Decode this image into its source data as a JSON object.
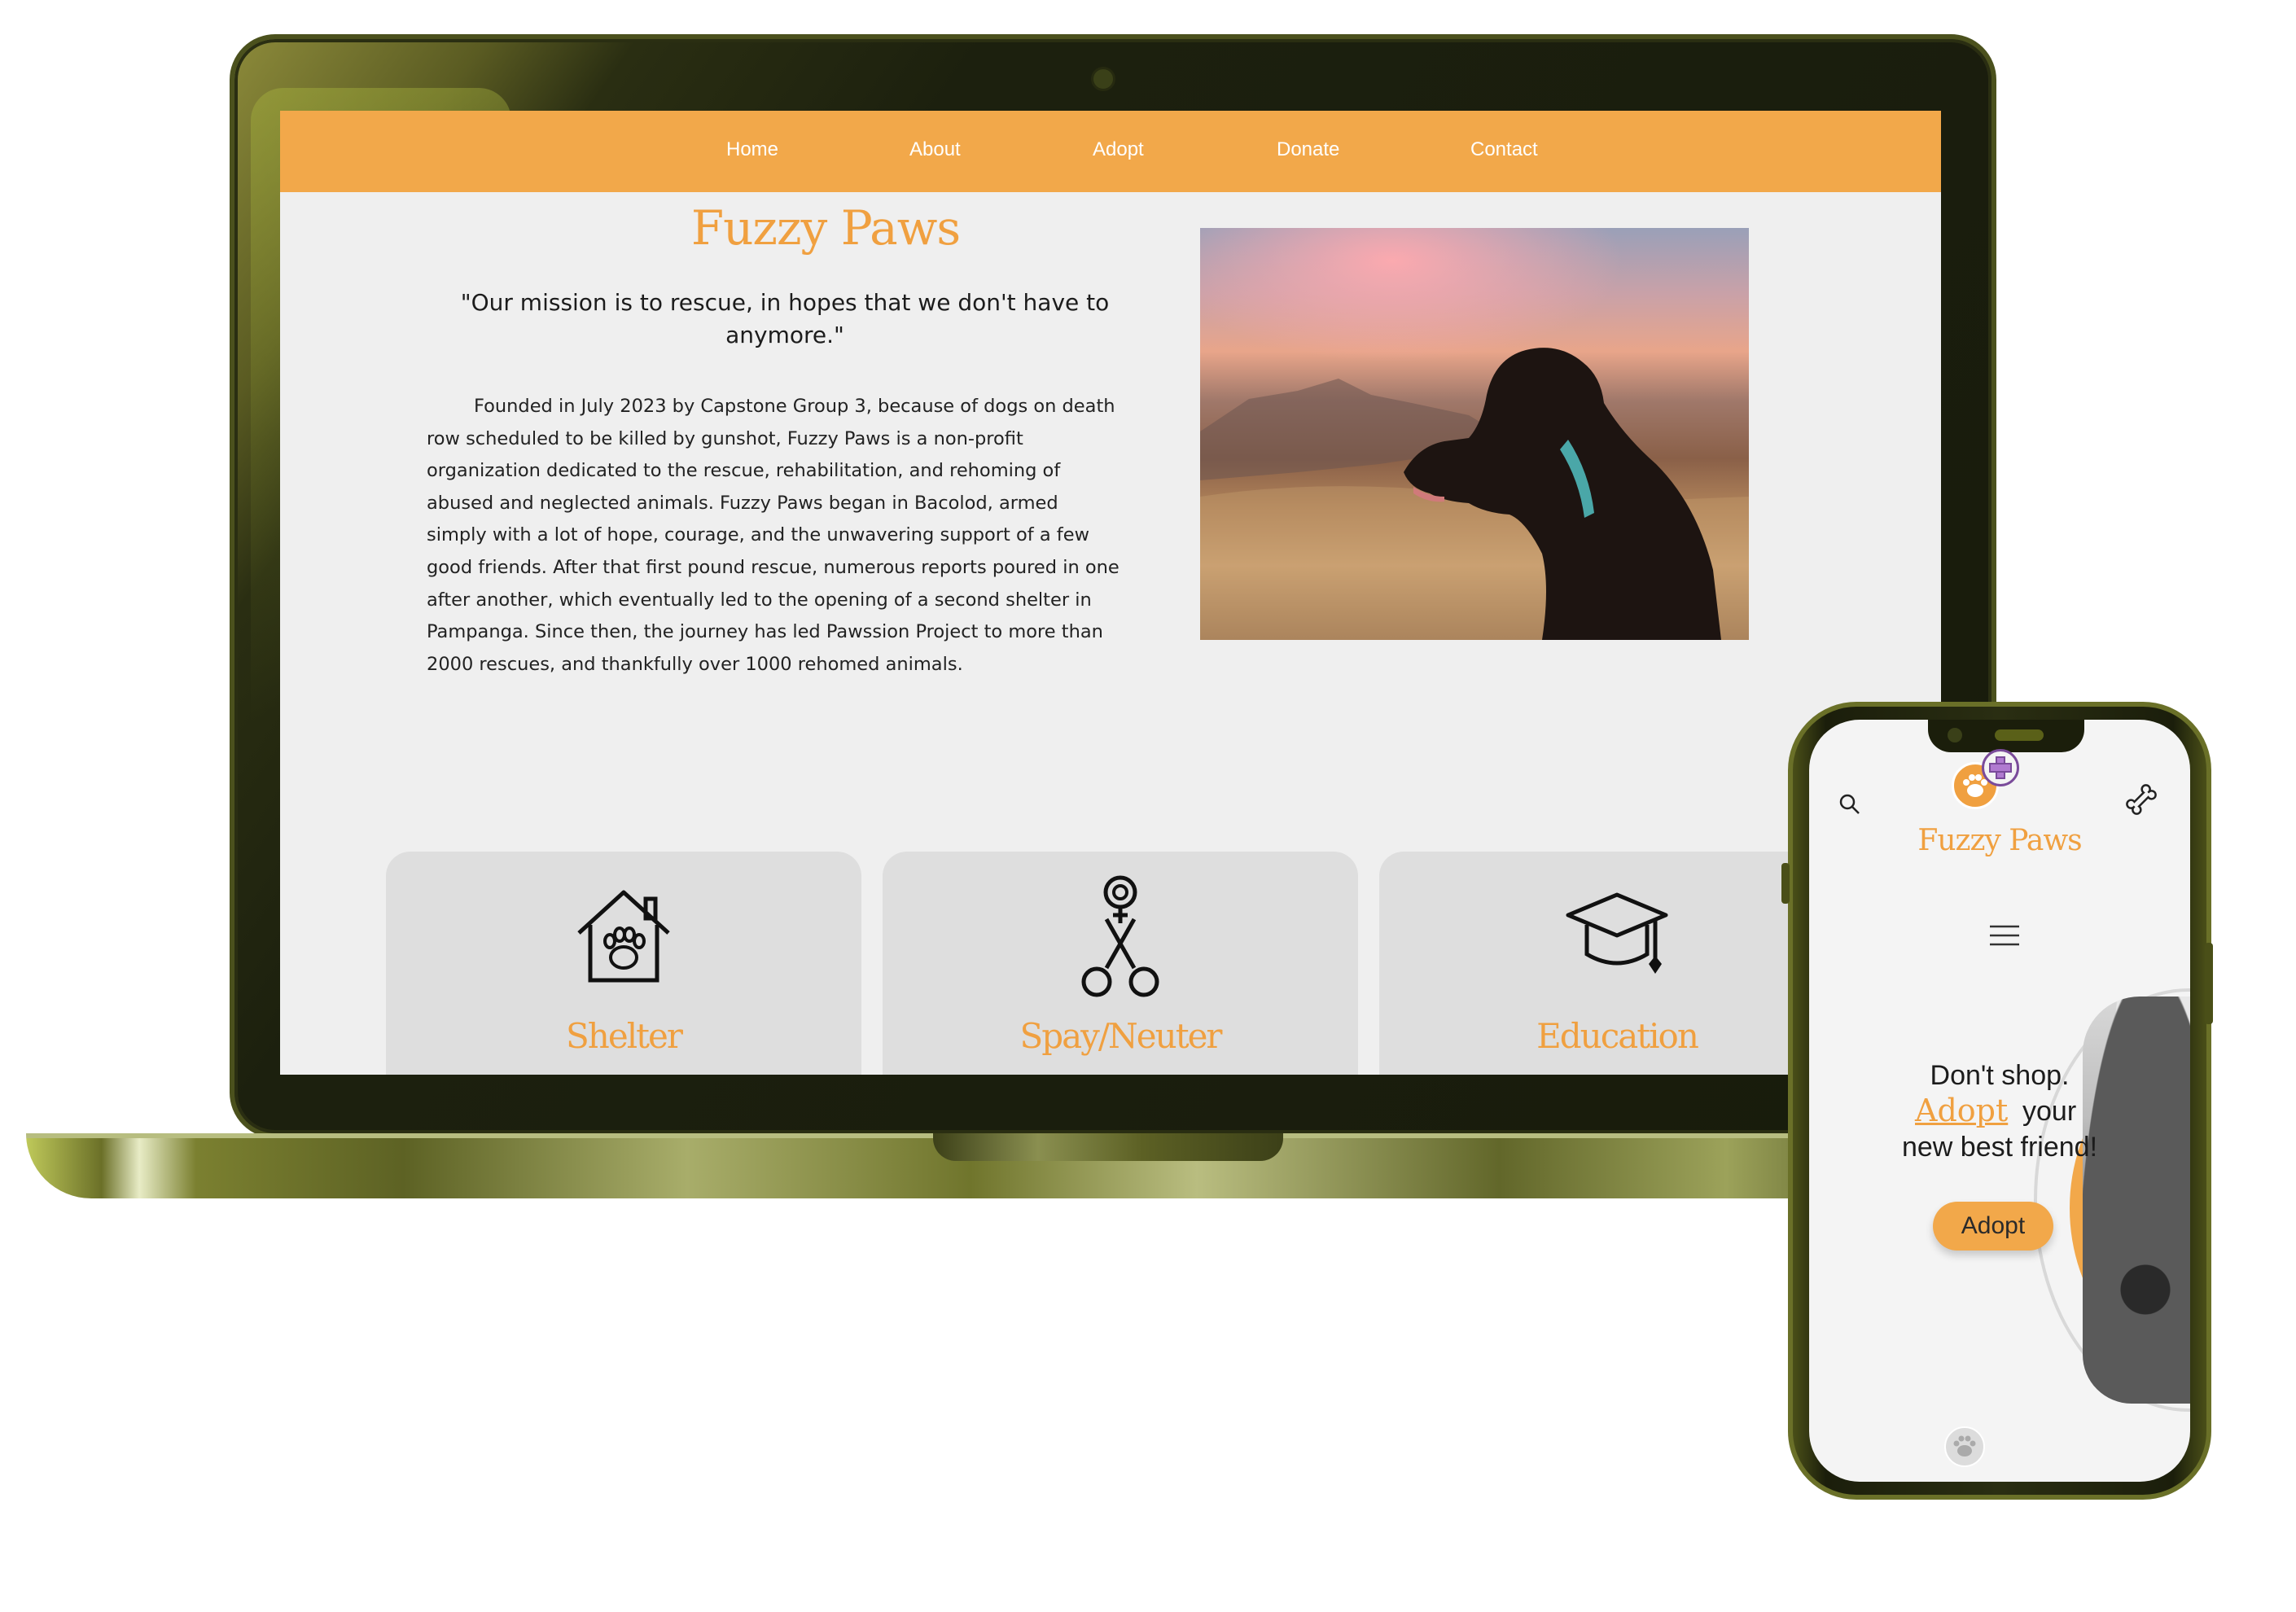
{
  "colors": {
    "accent": "#f2a84a",
    "brand_text": "#f0a040",
    "page_bg": "#efefef",
    "card_bg": "#dedede",
    "laptop_frame": "#1c200e"
  },
  "desktop": {
    "nav": [
      "Home",
      "About",
      "Adopt",
      "Donate",
      "Contact"
    ],
    "brand": "Fuzzy Paws",
    "mission": "\"Our mission is to rescue, in hopes that we don't have to anymore.\"",
    "about": "Founded in July 2023 by Capstone Group 3, because of dogs on death row scheduled to be killed by gunshot, Fuzzy Paws is a non-profit organization dedicated to the rescue, rehabilitation, and rehoming of abused and neglected animals. Fuzzy Paws began in Bacolod, armed simply with a lot of hope, courage, and the unwavering support of a few good friends. After that first pound rescue, numerous reports poured in one after another, which eventually led to the opening of a second shelter in Pampanga. Since then, the journey has led Pawssion Project to more than 2000 rescues, and thankfully over 1000 rehomed animals.",
    "cards": [
      {
        "title": "Shelter",
        "icon": "house-paw-icon"
      },
      {
        "title": "Spay/Neuter",
        "icon": "scissors-female-icon"
      },
      {
        "title": "Education",
        "icon": "graduation-cap-icon"
      }
    ]
  },
  "mobile": {
    "brand": "Fuzzy Paws",
    "tagline_line1": "Don't shop.",
    "tagline_adopt": "Adopt",
    "tagline_your": "your",
    "tagline_line3": "new best friend!",
    "adopt_button": "Adopt",
    "icons": [
      "search-icon",
      "paw-logo-icon",
      "medical-plus-icon",
      "bone-icon",
      "hamburger-menu-icon",
      "paw-icon"
    ]
  }
}
